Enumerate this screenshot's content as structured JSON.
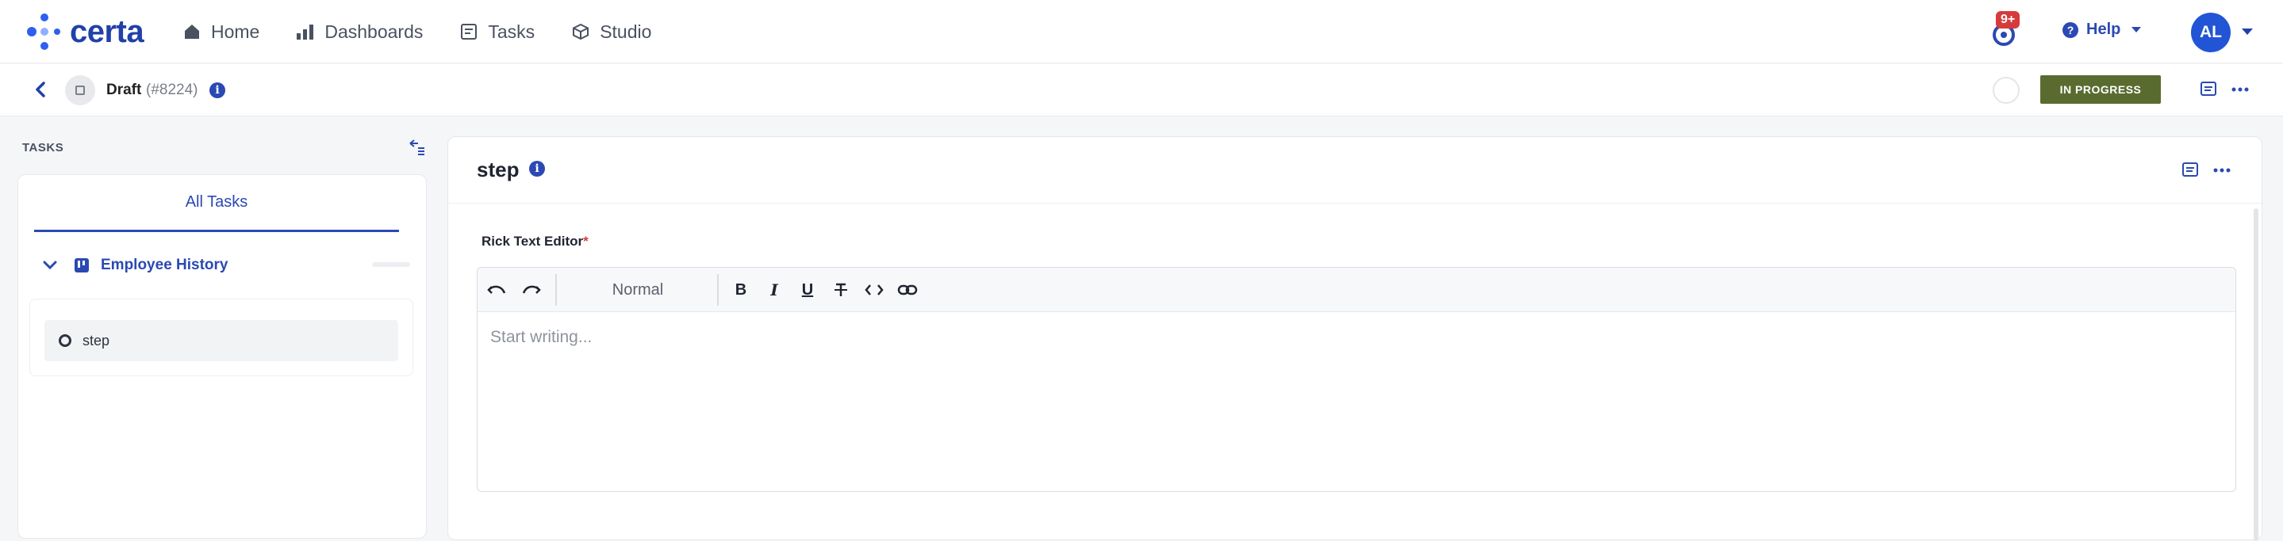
{
  "brand": {
    "name": "certa"
  },
  "nav": {
    "items": [
      {
        "label": "Home",
        "icon": "home-icon"
      },
      {
        "label": "Dashboards",
        "icon": "bar-chart-icon"
      },
      {
        "label": "Tasks",
        "icon": "clipboard-icon"
      },
      {
        "label": "Studio",
        "icon": "cube-icon"
      }
    ]
  },
  "topbar": {
    "notification_badge": "9+",
    "help_label": "Help",
    "avatar_initials": "AL"
  },
  "subbar": {
    "title": "Draft",
    "id": "(#8224)",
    "status": "IN PROGRESS"
  },
  "tasks_panel": {
    "heading": "TASKS",
    "tab_label": "All Tasks",
    "group_label": "Employee History",
    "tasks": [
      {
        "label": "step"
      }
    ]
  },
  "main": {
    "title": "step",
    "field_label": "Rick Text Editor",
    "required_marker": "*",
    "format_value": "Normal",
    "editor_placeholder": "Start writing..."
  },
  "colors": {
    "brand": "#2140a8",
    "accent": "#2b49b3",
    "status_bg": "#5a6b30",
    "badge": "#d63b3b"
  }
}
